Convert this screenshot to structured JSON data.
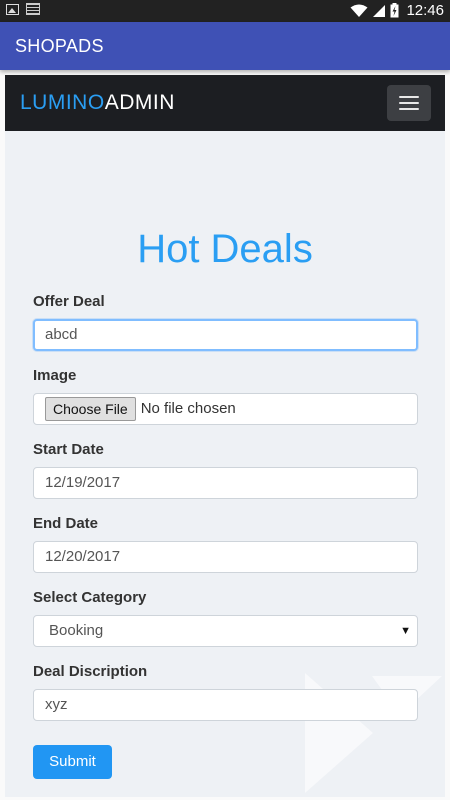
{
  "status_bar": {
    "time": "12:46"
  },
  "app_bar": {
    "title": "SHOPADS"
  },
  "navbar": {
    "brand_part1": "LUMINO",
    "brand_part2": "ADMIN"
  },
  "page": {
    "heading": "Hot Deals"
  },
  "form": {
    "offer_deal": {
      "label": "Offer Deal",
      "value": "abcd"
    },
    "image": {
      "label": "Image",
      "button": "Choose File",
      "status": "No file chosen"
    },
    "start_date": {
      "label": "Start Date",
      "value": "12/19/2017"
    },
    "end_date": {
      "label": "End Date",
      "value": "12/20/2017"
    },
    "category": {
      "label": "Select Category",
      "selected": "Booking"
    },
    "description": {
      "label": "Deal Discription",
      "value": "xyz"
    },
    "submit_label": "Submit"
  },
  "colors": {
    "app_bar": "#3f51b5",
    "accent": "#2a9ef3",
    "navbar": "#1c1e22",
    "submit": "#2196f3"
  }
}
